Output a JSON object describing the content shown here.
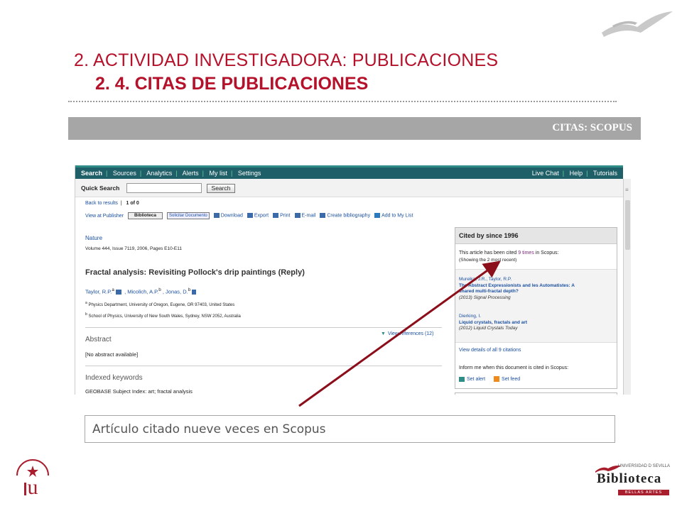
{
  "slide": {
    "title_main": "2. ACTIVIDAD INVESTIGADORA: PUBLICACIONES",
    "title_sub": "2. 4. CITAS DE PUBLICACIONES",
    "section_label": "CITAS: SCOPUS",
    "caption": "Artículo citado nueve veces en Scopus"
  },
  "nav": {
    "left": [
      "Search",
      "Sources",
      "Analytics",
      "Alerts",
      "My list",
      "Settings"
    ],
    "right": [
      "Live Chat",
      "Help",
      "Tutorials"
    ]
  },
  "quick_search": {
    "label": "Quick Search",
    "button": "Search",
    "value": ""
  },
  "record_nav": {
    "back": "Back to results",
    "count": "1 of 0"
  },
  "toolbar": {
    "view_publisher": "View at Publisher",
    "biblioteca": "Biblioteca",
    "solicitar": "Solicitar Documento",
    "download": "Download",
    "export": "Export",
    "print": "Print",
    "email": "E-mail",
    "bibliography": "Create bibliography",
    "add_list": "Add to My List"
  },
  "article": {
    "journal": "Nature",
    "volume": "Volume 444, Issue 7119, 2006, Pages E10-E11",
    "title": "Fractal analysis: Revisiting Pollock's drip paintings (Reply)",
    "author1": "Taylor, R.P.",
    "author1_sup": "a",
    "author2": ", Micolich, A.P.",
    "author2_sup": "b",
    "author3": ", Jonas, D.",
    "author3_sup": "b",
    "aff_a_sup": "a",
    "aff_a": "Physics Department, University of Oregon, Eugene, OR 97403, United States",
    "aff_b_sup": "b",
    "aff_b": "School of Physics, University of New South Wales, Sydney, NSW 2052, Australia",
    "abstract_heading": "Abstract",
    "view_references": "View references (12)",
    "no_abstract": "[No abstract available]",
    "indexed_heading": "Indexed keywords",
    "geobase": "GEOBASE Subject Index: art; fractal analysis"
  },
  "cited_by": {
    "heading": "Cited by since 1996",
    "text_pre": "This article has been cited ",
    "text_count": "9 times",
    "text_post": " in Scopus:",
    "showing": "(Showing the 2 most recent)",
    "citations": [
      {
        "authors": "Mureika, J.R., Taylor, R.P.",
        "title_line1": "The Abstract Expressionists and les Automatistes: A",
        "title_line2": "shared multi-fractal depth?",
        "source": "(2013) Signal Processing"
      },
      {
        "authors": "Dierking, I.",
        "title_line1": "Liquid crystals, fractals and art",
        "source": "(2012) Liquid Crystals Today"
      }
    ],
    "view_all": "View details of all 9 citations",
    "inform": "Inform me when this document is cited in Scopus:",
    "set_alert": "Set alert",
    "set_feed": "Set feed"
  },
  "logos": {
    "university_seal_text": "UNIVERSIDAD DE SEVILLA",
    "biblioteca_univ": "UNIVERSIDAD D SEVILLA",
    "biblioteca_name": "Biblioteca",
    "biblioteca_dept": "BELLAS ARTES"
  },
  "colors": {
    "title": "#b5112a",
    "nav": "#1f5f68",
    "arrow": "#8b0e1a",
    "section_bar": "#a6a6a6"
  }
}
